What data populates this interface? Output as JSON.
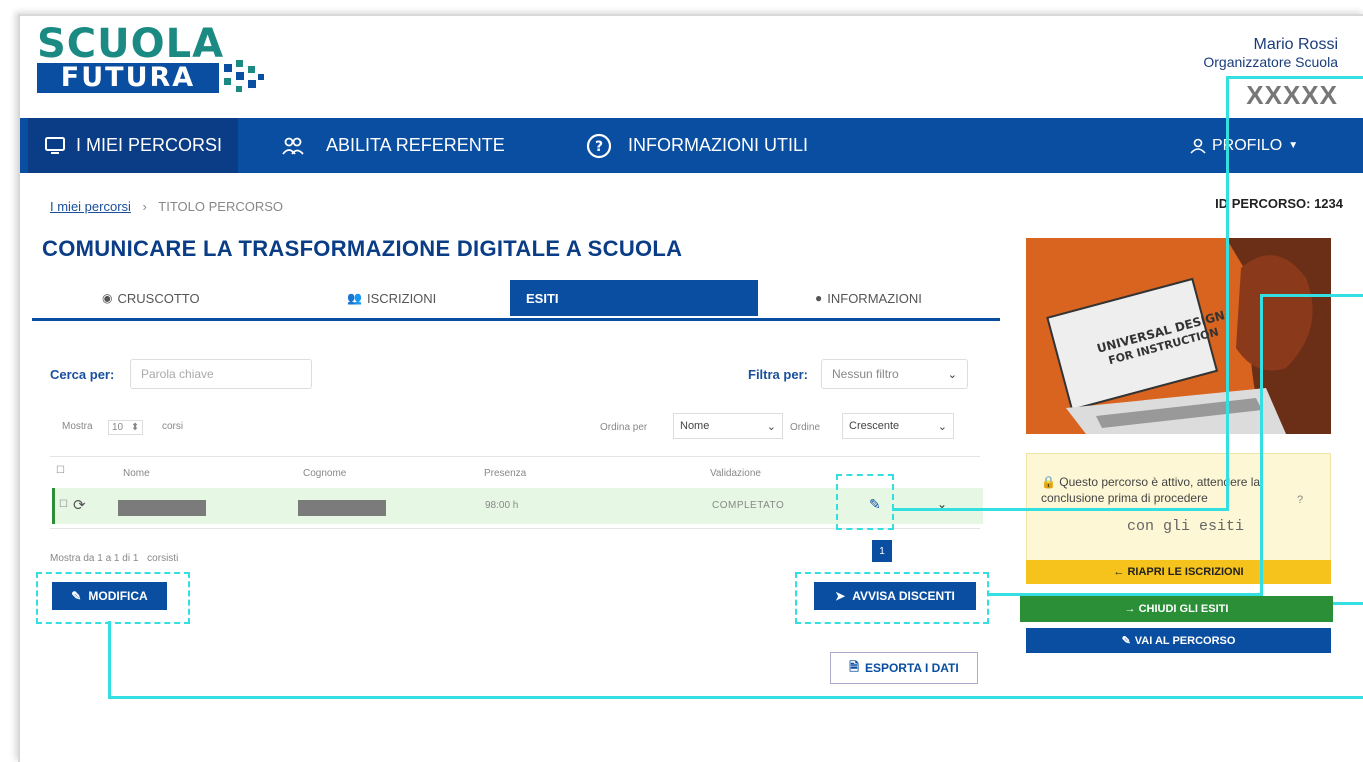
{
  "header": {
    "logo_top": "SCUOLA",
    "logo_bottom": "FUTURA",
    "user_name": "Mario Rossi",
    "user_role": "Organizzatore Scuola",
    "user_code": "XXXXX"
  },
  "nav": {
    "my_paths": "I MIEI PERCORSI",
    "enable_ref": "ABILITA REFERENTE",
    "info": "INFORMAZIONI UTILI",
    "profile": "PROFILO"
  },
  "breadcrumb": {
    "home": "I miei percorsi",
    "separator": "›",
    "current": "TITOLO PERCORSO"
  },
  "path_id": "ID PERCORSO: 1234",
  "page_title": "COMUNICARE LA TRASFORMAZIONE DIGITALE A SCUOLA",
  "tabs": {
    "dashboard": "CRUSCOTTO",
    "enrollments": "ISCRIZIONI",
    "results": "ESITI",
    "information": "INFORMAZIONI"
  },
  "filters": {
    "search_label": "Cerca per:",
    "search_placeholder": "Parola chiave",
    "filter_label": "Filtra per:",
    "filter_value": "Nessun filtro",
    "show_label": "Mostra",
    "show_value": "10",
    "show_suffix": "corsi",
    "sort_label": "Ordina per",
    "sort_value": "Nome",
    "order_label": "Ordine",
    "order_value": "Crescente"
  },
  "table": {
    "headers": [
      "Nome",
      "Cognome",
      "Presenza",
      "Validazione"
    ],
    "row": {
      "presence": "98:00 h",
      "status": "COMPLETATO"
    },
    "footer": "Mostra da 1 a 1 di 1",
    "footer_suffix": "corsisti",
    "page": "1"
  },
  "buttons": {
    "edit": "MODIFICA",
    "notify": "AVVISA DISCENTI",
    "export": "ESPORTA I DATI"
  },
  "sidebar": {
    "image_text_1": "UNIVERSAL DESIGN",
    "image_text_2": "FOR INSTRUCTION",
    "notice_text": "Questo percorso è attivo, attendere la conclusione prima di procedere",
    "notice_text2": "con gli esiti",
    "notice_q": "?",
    "reopen": "← RIAPRI LE ISCRIZIONI",
    "close_results": "→ CHIUDI GLI ESITI",
    "go_to_path": "VAI AL PERCORSO"
  },
  "colors": {
    "primary": "#0a4ea2",
    "highlight": "#34dfe2",
    "success": "#2a8f37",
    "warning": "#f5c31c",
    "teal": "#1a8a83"
  }
}
